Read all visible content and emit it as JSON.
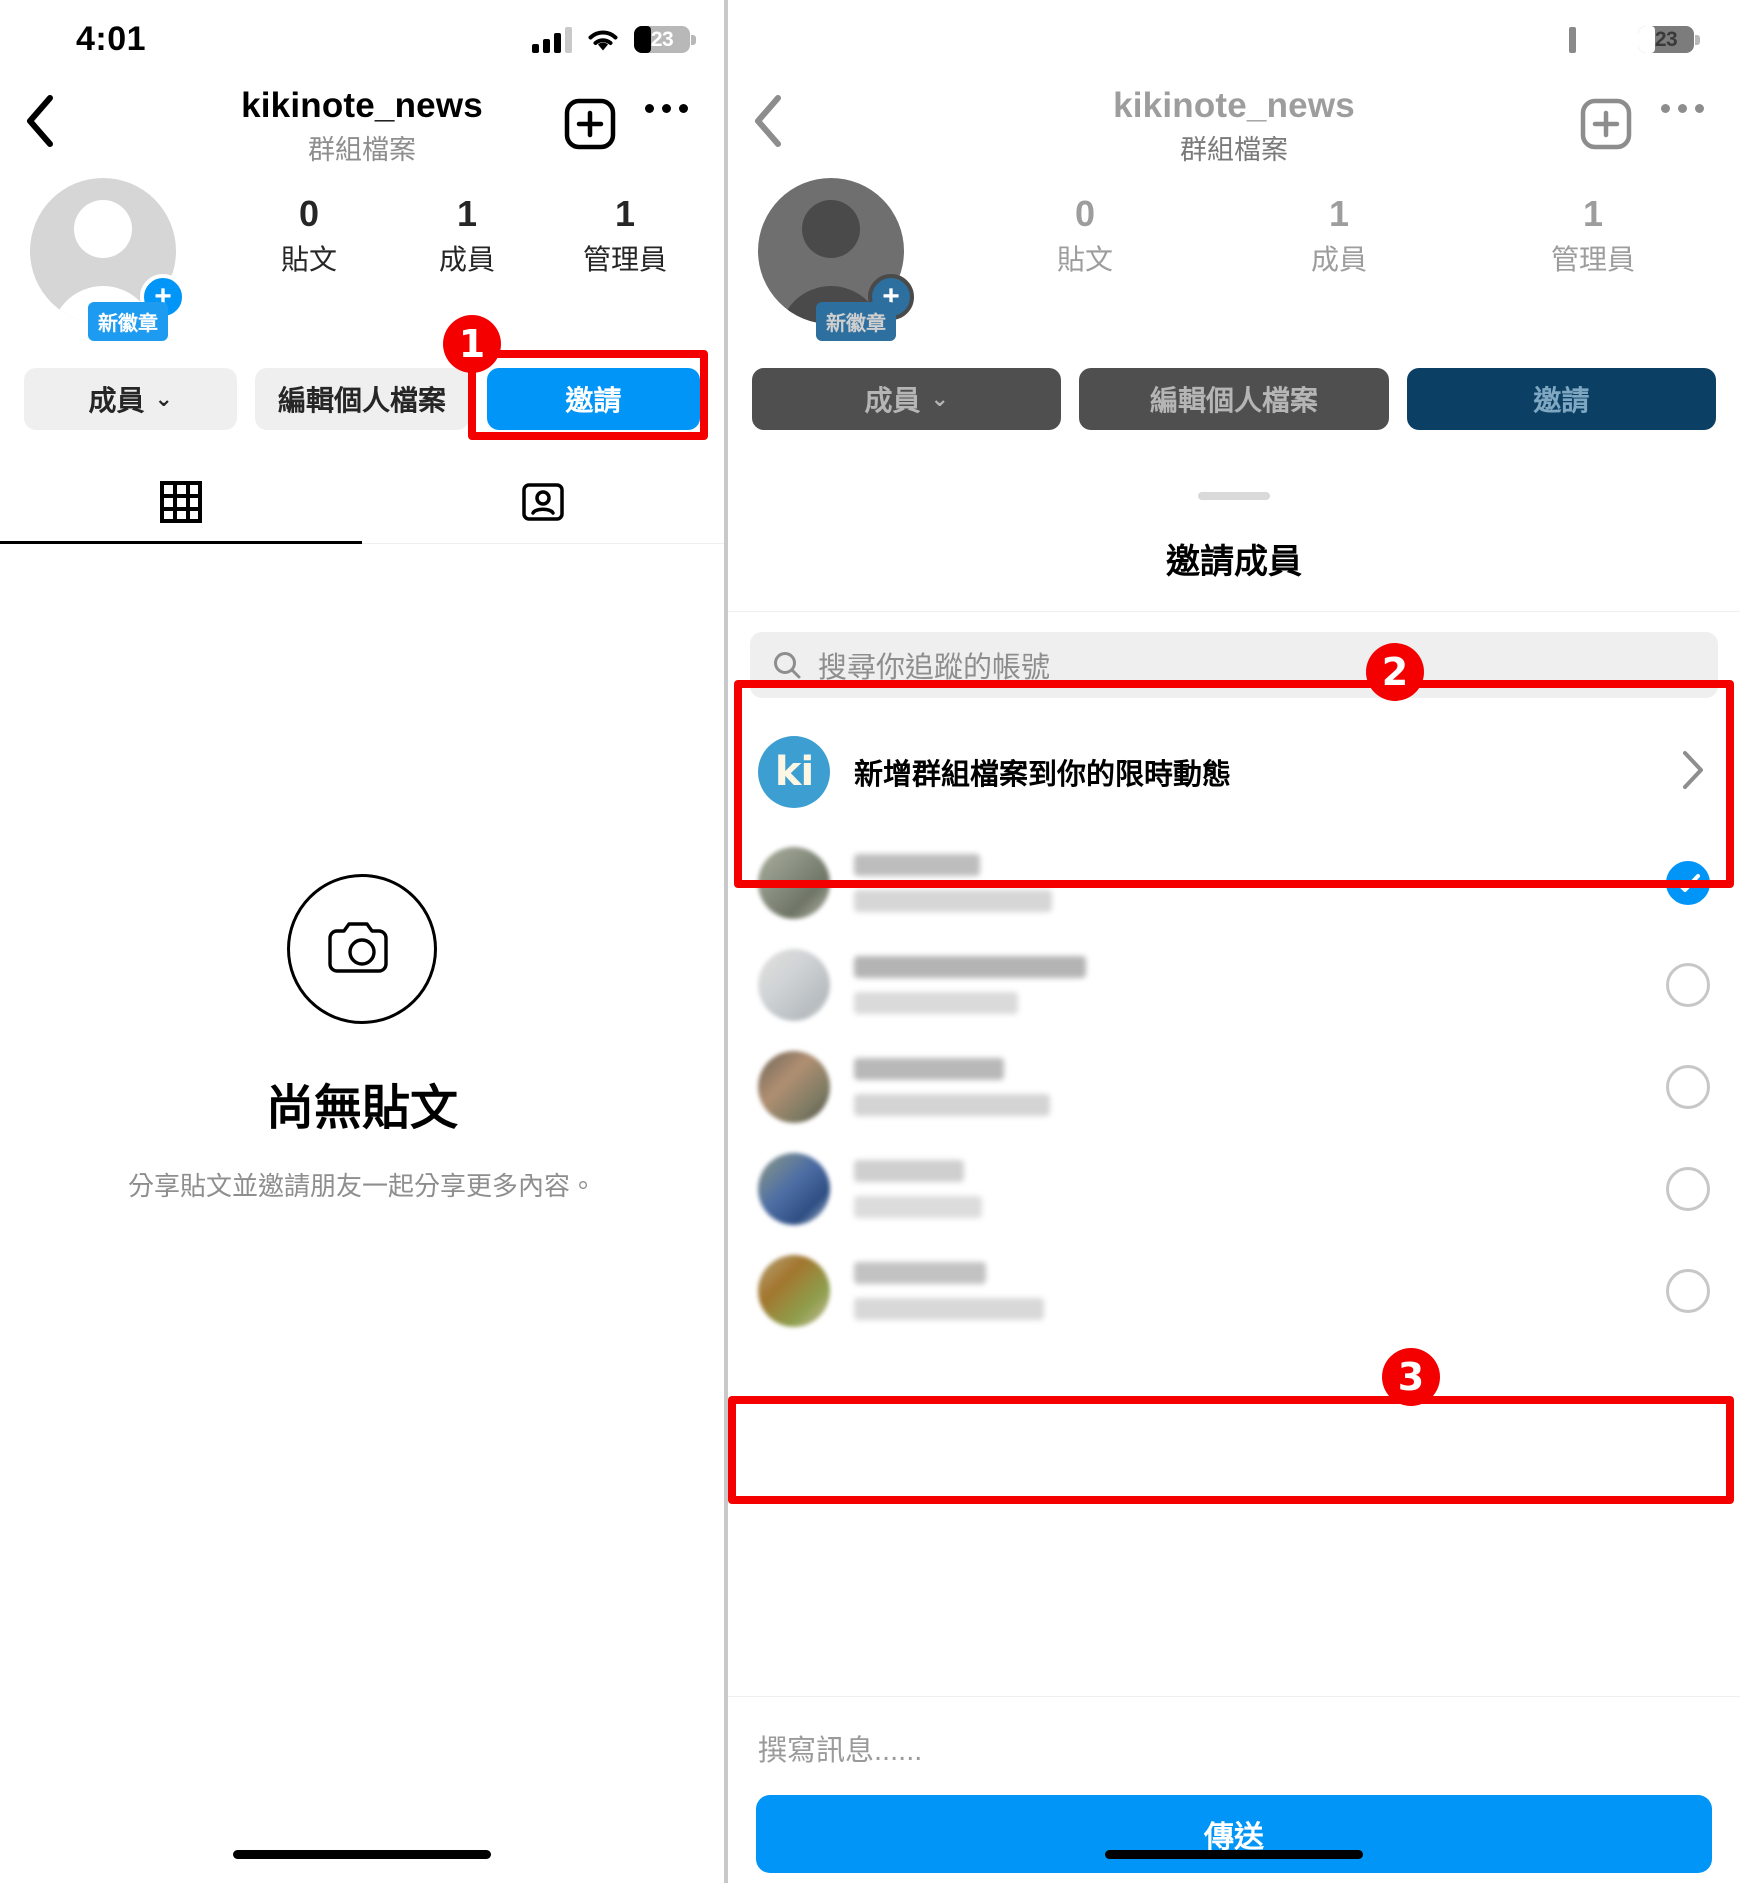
{
  "status_bar": {
    "time": "4:01",
    "battery_level": "23",
    "icons": [
      "cellular-signal-icon",
      "wifi-icon",
      "battery-icon"
    ]
  },
  "left_screen": {
    "nav": {
      "back_icon": "chevron-left-icon",
      "title": "kikinote_news",
      "subtitle": "群組檔案",
      "add_icon": "plus-square-icon",
      "more_icon": "ellipsis-icon"
    },
    "profile": {
      "avatar_icon": "default-avatar-icon",
      "add_avatar_icon": "plus-circle-icon",
      "badge_label": "新徽章",
      "stats": [
        {
          "num": "0",
          "label": "貼文"
        },
        {
          "num": "1",
          "label": "成員"
        },
        {
          "num": "1",
          "label": "管理員"
        }
      ]
    },
    "actions": {
      "members_label": "成員",
      "members_chevron": "chevron-down-icon",
      "edit_profile_label": "編輯個人檔案",
      "invite_label": "邀請"
    },
    "tabs": [
      {
        "icon": "grid-icon",
        "active": true
      },
      {
        "icon": "tagged-person-icon",
        "active": false
      }
    ],
    "empty_state": {
      "icon": "camera-circle-icon",
      "title": "尚無貼文",
      "subtitle": "分享貼文並邀請朋友一起分享更多內容。"
    }
  },
  "right_screen": {
    "nav": {
      "back_icon": "chevron-left-icon",
      "title": "kikinote_news",
      "subtitle": "群組檔案",
      "add_icon": "plus-square-icon",
      "more_icon": "ellipsis-icon"
    },
    "profile": {
      "badge_label": "新徽章",
      "stats": [
        {
          "num": "0",
          "label": "貼文"
        },
        {
          "num": "1",
          "label": "成員"
        },
        {
          "num": "1",
          "label": "管理員"
        }
      ]
    },
    "actions": {
      "members_label": "成員",
      "edit_profile_label": "編輯個人檔案",
      "invite_label": "邀請"
    },
    "sheet": {
      "grabber_icon": "sheet-grabber-icon",
      "title": "邀請成員",
      "search": {
        "icon": "search-icon",
        "placeholder": "搜尋你追蹤的帳號",
        "value": ""
      },
      "story_row": {
        "avatar_initials": "ki",
        "label": "新增群組檔案到你的限時動態",
        "chevron_icon": "chevron-right-icon"
      },
      "contacts": [
        {
          "avatar": "blurred-avatar",
          "name": "",
          "handle": "",
          "selected": true
        },
        {
          "avatar": "blurred-avatar",
          "name": "",
          "handle": "",
          "selected": false
        },
        {
          "avatar": "blurred-avatar",
          "name": "",
          "handle": "",
          "selected": false
        },
        {
          "avatar": "blurred-avatar",
          "name": "",
          "handle": "",
          "selected": false
        },
        {
          "avatar": "blurred-avatar",
          "name": "",
          "handle": "",
          "selected": false
        }
      ],
      "message": {
        "placeholder": "撰寫訊息......",
        "value": ""
      },
      "send_label": "傳送"
    }
  },
  "annotations": [
    {
      "number": "1",
      "target": "invite-button"
    },
    {
      "number": "2",
      "target": "story-and-first-contact-rows"
    },
    {
      "number": "3",
      "target": "send-button"
    }
  ],
  "colors": {
    "accent_blue": "#0095f6",
    "badge_blue": "#1d9bf0",
    "annotation_red": "#f40000",
    "muted_text": "#8e8e8e",
    "chip_grey": "#efefef"
  }
}
